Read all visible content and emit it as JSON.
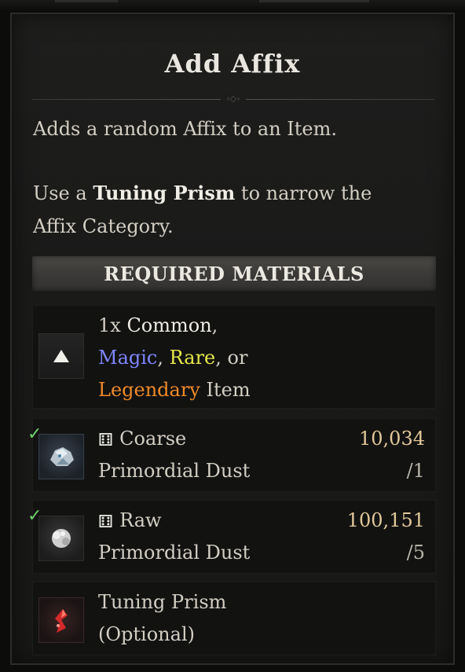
{
  "panel": {
    "title": "Add Affix",
    "divider_ornament": "‹◇›",
    "description": "Adds a random Affix to an Item.",
    "hint_prefix": "Use a ",
    "hint_bold": "Tuning Prism",
    "hint_suffix": " to narrow the",
    "hint_line2": "Affix Category."
  },
  "required_header": "REQUIRED MATERIALS",
  "item_requirement": {
    "icon": "triangle-up-icon",
    "line1_prefix": "1x ",
    "line1_common": "Common",
    "line1_suffix": ",",
    "magic": "Magic",
    "sep1": ", ",
    "rare": "Rare",
    "sep2": ", or",
    "legendary": "Legendary",
    "item_word": " Item"
  },
  "materials": [
    {
      "icon": "coarse-primordial-dust-icon",
      "met": true,
      "check_icon": "✓",
      "dice_icon": "⚅",
      "name_line1": "Coarse",
      "name_line2": "Primordial Dust",
      "owned": "10,034",
      "required": "/1"
    },
    {
      "icon": "raw-primordial-dust-icon",
      "met": true,
      "check_icon": "✓",
      "dice_icon": "⚅",
      "name_line1": "Raw",
      "name_line2": "Primordial Dust",
      "owned": "100,151",
      "required": "/5"
    },
    {
      "icon": "tuning-prism-icon",
      "name_line1": "Tuning Prism",
      "name_line2": "(Optional)"
    }
  ],
  "colors": {
    "magic": "#7f86ff",
    "rare": "#e6e64a",
    "legendary": "#ee8a2a",
    "check": "#6fd06a",
    "owned_amount": "#e2c89a"
  }
}
